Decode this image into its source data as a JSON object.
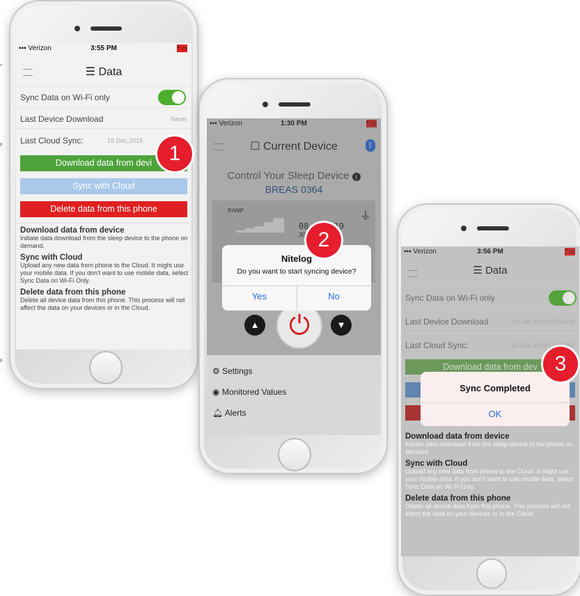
{
  "callout_badges": [
    "1",
    "2",
    "3"
  ],
  "phone1": {
    "status": {
      "carrier": "Verizon",
      "time": "3:55 PM",
      "battery": "* ▭"
    },
    "nav": {
      "title": "Data",
      "icon": "database-icon"
    },
    "rows": {
      "wifi_label": "Sync Data on Wi-Fi only",
      "download_label": "Last Device Download",
      "download_value": "Never",
      "cloud_label": "Last Cloud Sync:",
      "cloud_value": "16 Dec,2019"
    },
    "buttons": {
      "download": "Download data from devi",
      "sync": "Sync with Cloud",
      "delete": "Delete data from this phone"
    },
    "help": [
      {
        "title": "Download data from device",
        "text": "Initiate data download from the sleep device to the phone on demand."
      },
      {
        "title": "Sync with Cloud",
        "text": "Upload any new data from phone to the Cloud. It might use your mobile data. If you don't want to use mobile data, select Sync Data on Wi-Fi Only."
      },
      {
        "title": "Delete data from this phone",
        "text": "Delete all device data from this phone. This process will not affect the data on your devices or in the Cloud."
      }
    ],
    "wifi_only_on": true
  },
  "phone2": {
    "status": {
      "carrier": "Verizon",
      "time": "1:30 PM",
      "battery": "* ▭"
    },
    "nav": {
      "title": "Current Device",
      "icon": "device-icon",
      "bt_icon": "bluetooth-icon"
    },
    "control_title": "Control Your Sleep Device",
    "device_name": "BREAS 0364",
    "lcd": {
      "ramp": "RAMP",
      "date": "08-06- 19",
      "minutes": "30 MINU"
    },
    "dialog": {
      "title": "Nitelog",
      "message": "Do you want to start syncing device?",
      "yes": "Yes",
      "no": "No"
    },
    "menu": [
      {
        "label": "Settings",
        "icon": "gear-icon"
      },
      {
        "label": "Monitored Values",
        "icon": "eye-icon"
      },
      {
        "label": "Alerts",
        "icon": "bell-icon"
      }
    ]
  },
  "phone3": {
    "status": {
      "carrier": "Verizon",
      "time": "3:56 PM",
      "battery": "* ▭"
    },
    "nav": {
      "title": "Data",
      "icon": "database-icon"
    },
    "rows": {
      "wifi_label": "Sync Data on Wi-Fi only",
      "download_label": "Last Device Download",
      "download_value": "10 Jan,2020 03:56 PM",
      "cloud_label": "Last Cloud Sync:",
      "cloud_value": "16 Dec,2019 10:46 AM"
    },
    "buttons": {
      "download": "Download data from dev"
    },
    "dialog": {
      "title": "Sync Completed",
      "ok": "OK"
    },
    "help": [
      {
        "title": "Download data from device",
        "text": "Initiate data download from the sleep device to the phone on demand."
      },
      {
        "title": "Sync with Cloud",
        "text": "Upload any new data from phone to the Cloud. It might use your mobile data. If you don't want to use mobile data, select Sync Data on Wi-Fi Only."
      },
      {
        "title": "Delete data from this phone",
        "text": "Delete all device data from this phone. This process will not affect the data on your devices or in the Cloud."
      }
    ]
  }
}
